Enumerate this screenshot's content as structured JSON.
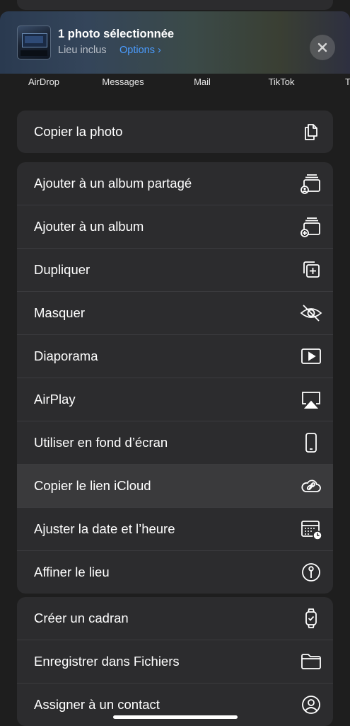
{
  "header": {
    "title": "1 photo sélectionnée",
    "subtitle": "Lieu inclus",
    "options_label": "Options",
    "options_chevron": "›"
  },
  "apps": [
    {
      "label": "AirDrop"
    },
    {
      "label": "Messages"
    },
    {
      "label": "Mail"
    },
    {
      "label": "TikTok"
    },
    {
      "label": "T"
    }
  ],
  "groups": [
    {
      "items": [
        {
          "label": "Copier la photo",
          "icon": "copy-icon"
        }
      ]
    },
    {
      "items": [
        {
          "label": "Ajouter à un album partagé",
          "icon": "shared-album-icon"
        },
        {
          "label": "Ajouter à un album",
          "icon": "add-album-icon"
        },
        {
          "label": "Dupliquer",
          "icon": "duplicate-icon"
        },
        {
          "label": "Masquer",
          "icon": "hide-icon"
        },
        {
          "label": "Diaporama",
          "icon": "slideshow-icon"
        },
        {
          "label": "AirPlay",
          "icon": "airplay-icon"
        },
        {
          "label": "Utiliser en fond d’écran",
          "icon": "phone-icon"
        },
        {
          "label": "Copier le lien iCloud",
          "icon": "icloud-link-icon"
        },
        {
          "label": "Ajuster la date et l’heure",
          "icon": "calendar-clock-icon"
        },
        {
          "label": "Affiner le lieu",
          "icon": "location-pin-icon"
        }
      ]
    },
    {
      "items": [
        {
          "label": "Créer un cadran",
          "icon": "watch-icon"
        },
        {
          "label": "Enregistrer dans Fichiers",
          "icon": "folder-icon"
        },
        {
          "label": "Assigner à un contact",
          "icon": "contact-icon"
        }
      ]
    }
  ],
  "colors": {
    "background": "#1e1e1e",
    "group_bg": "#2c2c2e",
    "highlight": "#3a3a3c",
    "accent": "#4a9cff"
  }
}
